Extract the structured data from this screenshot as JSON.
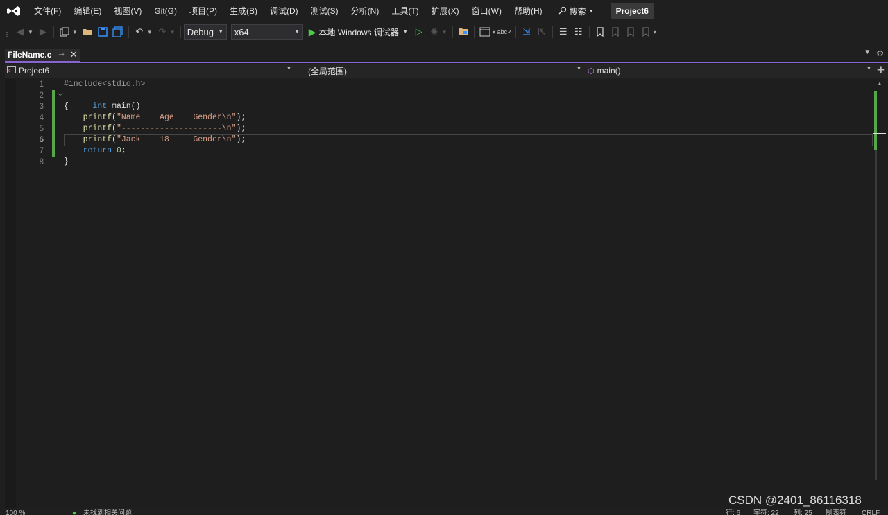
{
  "menu": {
    "items": [
      "文件(F)",
      "编辑(E)",
      "视图(V)",
      "Git(G)",
      "项目(P)",
      "生成(B)",
      "调试(D)",
      "测试(S)",
      "分析(N)",
      "工具(T)",
      "扩展(X)",
      "窗口(W)",
      "帮助(H)"
    ],
    "search_label": "搜索",
    "project_badge": "Project6"
  },
  "toolbar": {
    "config_value": "Debug",
    "platform_value": "x64",
    "run_label": "本地 Windows 调试器"
  },
  "tab": {
    "title": "FileName.c"
  },
  "navbar": {
    "project": "Project6",
    "scope": "(全局范围)",
    "member": "main()"
  },
  "editor": {
    "line_numbers": [
      "1",
      "2",
      "3",
      "4",
      "5",
      "6",
      "7",
      "8"
    ],
    "current_line": "6",
    "lines": [
      "#include<stdio.h>",
      "int main()",
      "{",
      "    printf(\"Name    Age    Gender\\n\");",
      "    printf(\"---------------------\\n\");",
      "    printf(\"Jack    18     Gender\\n\");",
      "    return 0;",
      "}"
    ]
  },
  "statusbar": {
    "zoom": "100 %",
    "issues": "未找到相关问题",
    "line": "行: 6",
    "char": "字符: 22",
    "col": "列: 25",
    "tabs": "制表符",
    "encoding": "CRLF"
  },
  "watermark": "CSDN @2401_86116318",
  "colors": {
    "accent": "#8a63d2",
    "change_marker": "#57a64a",
    "run_green": "#4ec94e",
    "keyword": "#569cd6",
    "string": "#d69d85"
  }
}
